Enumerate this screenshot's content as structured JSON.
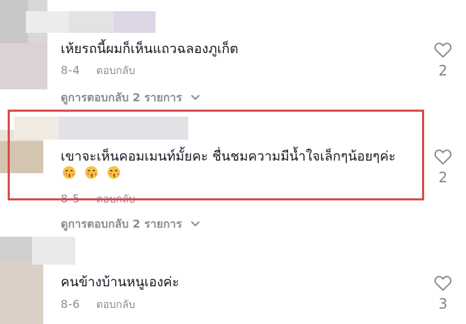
{
  "comments": [
    {
      "text": "เห้ยรถนี้ผมก็เห็นแถวฉลองภูเก็ต",
      "date": "8-4",
      "reply_label": "ตอบกลับ",
      "view_replies": "ดูการตอบกลับ 2 รายการ",
      "like_count": "2"
    },
    {
      "text": "เขาจะเห็นคอมเมนท์มั้ยคะ ชื่นชมความมีน้ำใจเล็กๆน้อยๆค่ะ",
      "emoji": [
        "kiss-face-emoji",
        "kiss-face-emoji",
        "kiss-face-emoji"
      ],
      "date": "8-5",
      "reply_label": "ตอบกลับ",
      "view_replies": "ดูการตอบกลับ 2 รายการ",
      "like_count": "2"
    },
    {
      "text": "คนข้างบ้านหนูเองค่ะ",
      "date": "8-6",
      "reply_label": "ตอบกลับ",
      "like_count": "3"
    }
  ],
  "colors": {
    "text": "#161823",
    "secondary_text": "#8a8b91",
    "highlight_border": "#d84a4a",
    "heart_outline": "#8a8b91"
  }
}
